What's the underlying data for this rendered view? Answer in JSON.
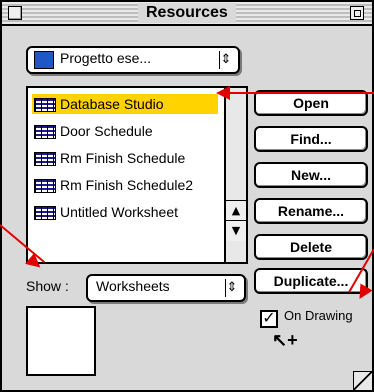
{
  "window": {
    "title": "Resources"
  },
  "project_popup": {
    "label": "Progetto ese...",
    "arrow": "⇕"
  },
  "list": {
    "items": [
      {
        "label": "Database Studio",
        "selected": true
      },
      {
        "label": "Door Schedule",
        "selected": false
      },
      {
        "label": "Rm Finish Schedule",
        "selected": false
      },
      {
        "label": "Rm Finish Schedule2",
        "selected": false
      },
      {
        "label": "Untitled Worksheet",
        "selected": false
      }
    ]
  },
  "buttons": {
    "open": "Open",
    "find": "Find...",
    "new": "New...",
    "rename": "Rename...",
    "delete": "Delete",
    "duplicate": "Duplicate..."
  },
  "show": {
    "label": "Show :",
    "value": "Worksheets",
    "arrow": "⇕"
  },
  "on_drawing": {
    "label": "On Drawing",
    "checked": true,
    "mark": "✓"
  },
  "colors": {
    "selection": "#ffd300",
    "annotation": "#e00000"
  },
  "icons": {
    "cursor": "↖+"
  }
}
